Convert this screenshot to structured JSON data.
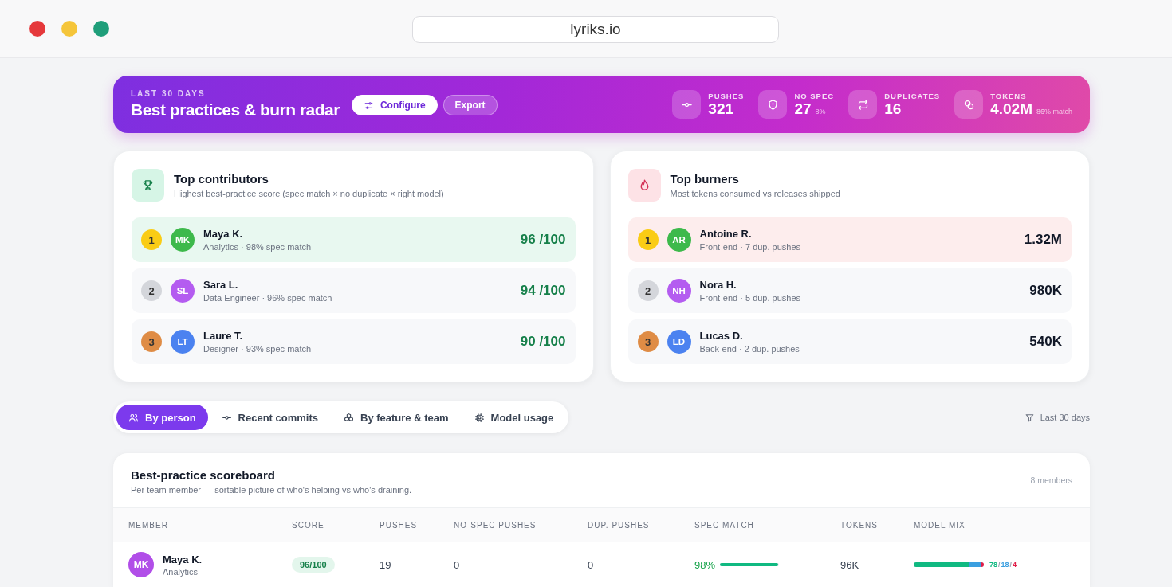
{
  "browser": {
    "url": "lyriks.io"
  },
  "hero": {
    "eyebrow": "LAST 30 DAYS",
    "title": "Best practices & burn radar",
    "buttons": [
      {
        "label": "Configure",
        "kind": "primary"
      },
      {
        "label": "Export",
        "kind": "ghost"
      }
    ],
    "stats": [
      {
        "label": "PUSHES",
        "value": "321"
      },
      {
        "label": "NO SPEC",
        "value": "27",
        "note": "8%"
      },
      {
        "label": "DUPLICATES",
        "value": "16"
      },
      {
        "label": "TOKENS",
        "value": "4.02M",
        "note": "86% match"
      }
    ]
  },
  "cards": [
    {
      "kind": "contributors",
      "title": "Top contributors",
      "subtitle": "Highest best-practice score (spec match × no duplicate × right model)",
      "rows": [
        {
          "rank": "1",
          "initials": "MK",
          "color": "#3db94b",
          "name": "Maya K.",
          "detail": "Analytics · 98% spec match",
          "value": "96 /100",
          "highlighted": true
        },
        {
          "rank": "2",
          "initials": "SL",
          "color": "#b45cf0",
          "name": "Sara L.",
          "detail": "Data Engineer · 96% spec match",
          "value": "94 /100",
          "highlighted": false
        },
        {
          "rank": "3",
          "initials": "LT",
          "color": "#4b82f0",
          "name": "Laure T.",
          "detail": "Designer · 93% spec match",
          "value": "90 /100",
          "highlighted": false
        }
      ]
    },
    {
      "kind": "burners",
      "title": "Top burners",
      "subtitle": "Most tokens consumed vs releases shipped",
      "rows": [
        {
          "rank": "1",
          "initials": "AR",
          "color": "#3db94b",
          "name": "Antoine R.",
          "detail": "Front-end · 7 dup. pushes",
          "value": "1.32M",
          "highlighted": true
        },
        {
          "rank": "2",
          "initials": "NH",
          "color": "#b45cf0",
          "name": "Nora H.",
          "detail": "Front-end · 5 dup. pushes",
          "value": "980K",
          "highlighted": false
        },
        {
          "rank": "3",
          "initials": "LD",
          "color": "#4b82f0",
          "name": "Lucas D.",
          "detail": "Back-end · 2 dup. pushes",
          "value": "540K",
          "highlighted": false
        }
      ]
    }
  ],
  "tabs": [
    {
      "label": "By person",
      "selected": true
    },
    {
      "label": "Recent commits",
      "selected": false
    },
    {
      "label": "By feature & team",
      "selected": false
    },
    {
      "label": "Model usage",
      "selected": false
    }
  ],
  "filter": {
    "label": "Last 30 days"
  },
  "scoreboard": {
    "title": "Best-practice scoreboard",
    "subtitle": "Per team member — sortable picture of who's helping vs who's draining.",
    "count": "8 members",
    "columns": [
      "MEMBER",
      "SCORE",
      "PUSHES",
      "NO-SPEC PUSHES",
      "DUP. PUSHES",
      "SPEC MATCH",
      "TOKENS",
      "MODEL MIX"
    ],
    "rows": [
      {
        "initials": "MK",
        "color": "#b14ee8",
        "name": "Maya K.",
        "team": "Analytics",
        "score": "96/100",
        "pushes": "19",
        "no_spec": "0",
        "dup": "0",
        "spec": "98%",
        "level": 0.98,
        "tokens": "96K",
        "mix": [
          {
            "value": "78",
            "level": 0.78,
            "color": "#10b981"
          },
          {
            "separator": "/",
            "value": "18",
            "level": 0.18,
            "color": "#3b9fe0"
          },
          {
            "separator": "/",
            "value": "4",
            "level": 0.04,
            "color": "#e11d48"
          }
        ]
      }
    ]
  }
}
